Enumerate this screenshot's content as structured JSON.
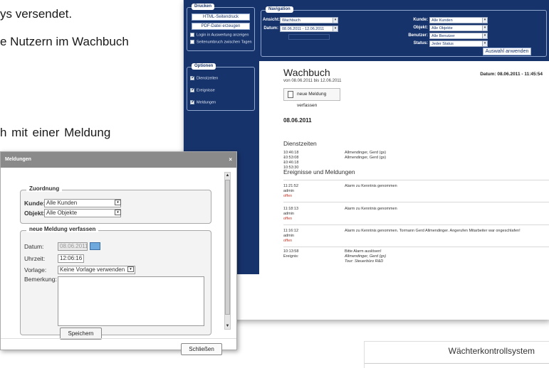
{
  "document": {
    "line1": "ys versendet.",
    "line2": "e Nutzern im Wachbuch",
    "line3": "h  mit  einer  Meldung"
  },
  "app": {
    "drucken": {
      "title": "Drucken",
      "html_button": "HTML-Seitendruck",
      "pdf_button": "PDF-Datei erzeugen",
      "opt1": "Login in Auswertung anzeigen",
      "opt2": "Seitenumbruch zwischen Tagen"
    },
    "navigation": {
      "title": "Navigation",
      "ansicht_label": "Ansicht:",
      "ansicht_value": "Wachbuch",
      "datum_label": "Datum:",
      "datum_value": "08.06.2011 - 12.06.2011",
      "kunde_label": "Kunde:",
      "kunde_value": "Alle Kunden",
      "objekt_label": "Objekt:",
      "objekt_value": "Alle Objekte",
      "benutzer_label": "Benutzer:",
      "benutzer_value": "Alle Benutzer",
      "status_label": "Status:",
      "status_value": "Jeder Status",
      "apply_button": "Auswahl anwenden"
    },
    "optionen": {
      "title": "Optionen",
      "items": [
        "Dienstzeiten",
        "Ereignisse",
        "Meldungen"
      ]
    },
    "content": {
      "title": "Wachbuch",
      "range": "von 08.06.2011 bis 12.06.2011",
      "date_time": "Datum: 08.06.2011 - 11:45:54",
      "new_button": "neue Meldung verfassen",
      "day": "08.06.2011",
      "dienstzeiten_heading": "Dienstzeiten",
      "dienst_rows": [
        {
          "time": "10:46:18 - 10:46:18",
          "desc": "Allmendinger, Gerd (gs)"
        },
        {
          "time": "10:53:08 - 10:53:30",
          "desc": "Allmendinger, Gerd (gs)"
        }
      ],
      "ereignisse_heading": "Ereignisse und Meldungen",
      "event_rows": [
        {
          "time": "11:21:52",
          "user": "admin",
          "status": "offen",
          "desc": "Alarm zu Kenntnis genommen"
        },
        {
          "time": "11:18:13",
          "user": "admin",
          "status": "offen",
          "desc": "Alarm zu Kenntnis genommen"
        },
        {
          "time": "11:16:12",
          "user": "admin",
          "status": "offen",
          "desc": "Alarm zu Kenntnis genommen. Tormann Gerd Allmendinger. Angerufen Mitarbeiter war ongeschlafen!"
        }
      ],
      "last_row": {
        "time": "10:13:58 Ereignis:",
        "desc1": "Bitte Alarm auslösen!",
        "desc2": "Allmendinger, Gerd (gs)",
        "desc3": "Tour: Steuerbüro R&D"
      }
    }
  },
  "dialog": {
    "title": "Meldungen",
    "close": "×",
    "zuordnung": {
      "legend": "Zuordnung",
      "kunde_label": "Kunde:",
      "kunde_value": "Alle Kunden",
      "objekt_label": "Objekt:",
      "objekt_value": "Alle Objekte"
    },
    "neue": {
      "legend": "neue Meldung verfassen",
      "datum_label": "Datum:",
      "datum_value": "08.06.2011",
      "uhrzeit_label": "Uhrzeit:",
      "uhrzeit_value": "12:06:16",
      "vorlage_label": "Vorlage:",
      "vorlage_value": "Keine Vorlage verwenden",
      "bemerkung_label": "Bemerkung:",
      "save_button": "Speichern"
    },
    "close_button": "Schließen"
  },
  "wks": {
    "title": "Wächterkontrollsystem"
  }
}
